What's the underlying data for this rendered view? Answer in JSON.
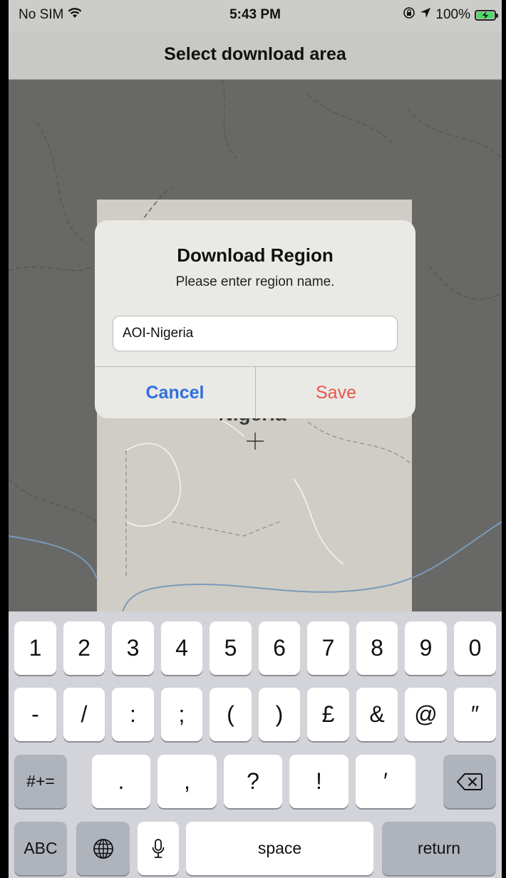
{
  "status_bar": {
    "carrier": "No SIM",
    "time": "5:43 PM",
    "battery": "100%",
    "icons": [
      "wifi-icon",
      "lock-rotation-icon",
      "location-arrow-icon",
      "battery-charging-icon"
    ]
  },
  "nav": {
    "title": "Select download area"
  },
  "map": {
    "country_label": "Nigeria"
  },
  "dialog": {
    "title": "Download Region",
    "message": "Please enter region name.",
    "input_value": "AOI-Nigeria",
    "cancel_label": "Cancel",
    "save_label": "Save"
  },
  "keyboard": {
    "row1": [
      "1",
      "2",
      "3",
      "4",
      "5",
      "6",
      "7",
      "8",
      "9",
      "0"
    ],
    "row2": [
      "-",
      "/",
      ":",
      ";",
      "(",
      ")",
      "£",
      "&",
      "@",
      "″"
    ],
    "row3": [
      "#+=",
      ".",
      ",",
      "?",
      "!",
      "′"
    ],
    "bottom": {
      "abc": "ABC",
      "space": "space",
      "return": "return"
    },
    "icons": [
      "delete-icon",
      "globe-icon",
      "microphone-icon"
    ]
  },
  "colors": {
    "cancel": "#2f6fdf",
    "save": "#e8554a",
    "map_dim": "#686866",
    "selection": "#cfcdc5"
  }
}
